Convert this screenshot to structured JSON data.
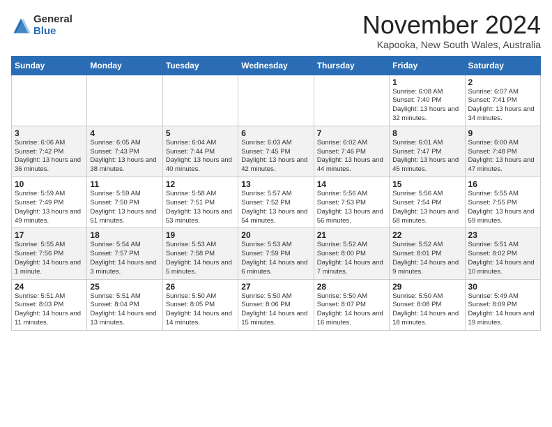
{
  "header": {
    "logo_general": "General",
    "logo_blue": "Blue",
    "month_title": "November 2024",
    "location": "Kapooka, New South Wales, Australia"
  },
  "weekdays": [
    "Sunday",
    "Monday",
    "Tuesday",
    "Wednesday",
    "Thursday",
    "Friday",
    "Saturday"
  ],
  "weeks": [
    [
      {
        "day": "",
        "info": ""
      },
      {
        "day": "",
        "info": ""
      },
      {
        "day": "",
        "info": ""
      },
      {
        "day": "",
        "info": ""
      },
      {
        "day": "",
        "info": ""
      },
      {
        "day": "1",
        "info": "Sunrise: 6:08 AM\nSunset: 7:40 PM\nDaylight: 13 hours\nand 32 minutes."
      },
      {
        "day": "2",
        "info": "Sunrise: 6:07 AM\nSunset: 7:41 PM\nDaylight: 13 hours\nand 34 minutes."
      }
    ],
    [
      {
        "day": "3",
        "info": "Sunrise: 6:06 AM\nSunset: 7:42 PM\nDaylight: 13 hours\nand 36 minutes."
      },
      {
        "day": "4",
        "info": "Sunrise: 6:05 AM\nSunset: 7:43 PM\nDaylight: 13 hours\nand 38 minutes."
      },
      {
        "day": "5",
        "info": "Sunrise: 6:04 AM\nSunset: 7:44 PM\nDaylight: 13 hours\nand 40 minutes."
      },
      {
        "day": "6",
        "info": "Sunrise: 6:03 AM\nSunset: 7:45 PM\nDaylight: 13 hours\nand 42 minutes."
      },
      {
        "day": "7",
        "info": "Sunrise: 6:02 AM\nSunset: 7:46 PM\nDaylight: 13 hours\nand 44 minutes."
      },
      {
        "day": "8",
        "info": "Sunrise: 6:01 AM\nSunset: 7:47 PM\nDaylight: 13 hours\nand 45 minutes."
      },
      {
        "day": "9",
        "info": "Sunrise: 6:00 AM\nSunset: 7:48 PM\nDaylight: 13 hours\nand 47 minutes."
      }
    ],
    [
      {
        "day": "10",
        "info": "Sunrise: 5:59 AM\nSunset: 7:49 PM\nDaylight: 13 hours\nand 49 minutes."
      },
      {
        "day": "11",
        "info": "Sunrise: 5:59 AM\nSunset: 7:50 PM\nDaylight: 13 hours\nand 51 minutes."
      },
      {
        "day": "12",
        "info": "Sunrise: 5:58 AM\nSunset: 7:51 PM\nDaylight: 13 hours\nand 53 minutes."
      },
      {
        "day": "13",
        "info": "Sunrise: 5:57 AM\nSunset: 7:52 PM\nDaylight: 13 hours\nand 54 minutes."
      },
      {
        "day": "14",
        "info": "Sunrise: 5:56 AM\nSunset: 7:53 PM\nDaylight: 13 hours\nand 56 minutes."
      },
      {
        "day": "15",
        "info": "Sunrise: 5:56 AM\nSunset: 7:54 PM\nDaylight: 13 hours\nand 58 minutes."
      },
      {
        "day": "16",
        "info": "Sunrise: 5:55 AM\nSunset: 7:55 PM\nDaylight: 13 hours\nand 59 minutes."
      }
    ],
    [
      {
        "day": "17",
        "info": "Sunrise: 5:55 AM\nSunset: 7:56 PM\nDaylight: 14 hours\nand 1 minute."
      },
      {
        "day": "18",
        "info": "Sunrise: 5:54 AM\nSunset: 7:57 PM\nDaylight: 14 hours\nand 3 minutes."
      },
      {
        "day": "19",
        "info": "Sunrise: 5:53 AM\nSunset: 7:58 PM\nDaylight: 14 hours\nand 5 minutes."
      },
      {
        "day": "20",
        "info": "Sunrise: 5:53 AM\nSunset: 7:59 PM\nDaylight: 14 hours\nand 6 minutes."
      },
      {
        "day": "21",
        "info": "Sunrise: 5:52 AM\nSunset: 8:00 PM\nDaylight: 14 hours\nand 7 minutes."
      },
      {
        "day": "22",
        "info": "Sunrise: 5:52 AM\nSunset: 8:01 PM\nDaylight: 14 hours\nand 9 minutes."
      },
      {
        "day": "23",
        "info": "Sunrise: 5:51 AM\nSunset: 8:02 PM\nDaylight: 14 hours\nand 10 minutes."
      }
    ],
    [
      {
        "day": "24",
        "info": "Sunrise: 5:51 AM\nSunset: 8:03 PM\nDaylight: 14 hours\nand 11 minutes."
      },
      {
        "day": "25",
        "info": "Sunrise: 5:51 AM\nSunset: 8:04 PM\nDaylight: 14 hours\nand 13 minutes."
      },
      {
        "day": "26",
        "info": "Sunrise: 5:50 AM\nSunset: 8:05 PM\nDaylight: 14 hours\nand 14 minutes."
      },
      {
        "day": "27",
        "info": "Sunrise: 5:50 AM\nSunset: 8:06 PM\nDaylight: 14 hours\nand 15 minutes."
      },
      {
        "day": "28",
        "info": "Sunrise: 5:50 AM\nSunset: 8:07 PM\nDaylight: 14 hours\nand 16 minutes."
      },
      {
        "day": "29",
        "info": "Sunrise: 5:50 AM\nSunset: 8:08 PM\nDaylight: 14 hours\nand 18 minutes."
      },
      {
        "day": "30",
        "info": "Sunrise: 5:49 AM\nSunset: 8:09 PM\nDaylight: 14 hours\nand 19 minutes."
      }
    ]
  ]
}
